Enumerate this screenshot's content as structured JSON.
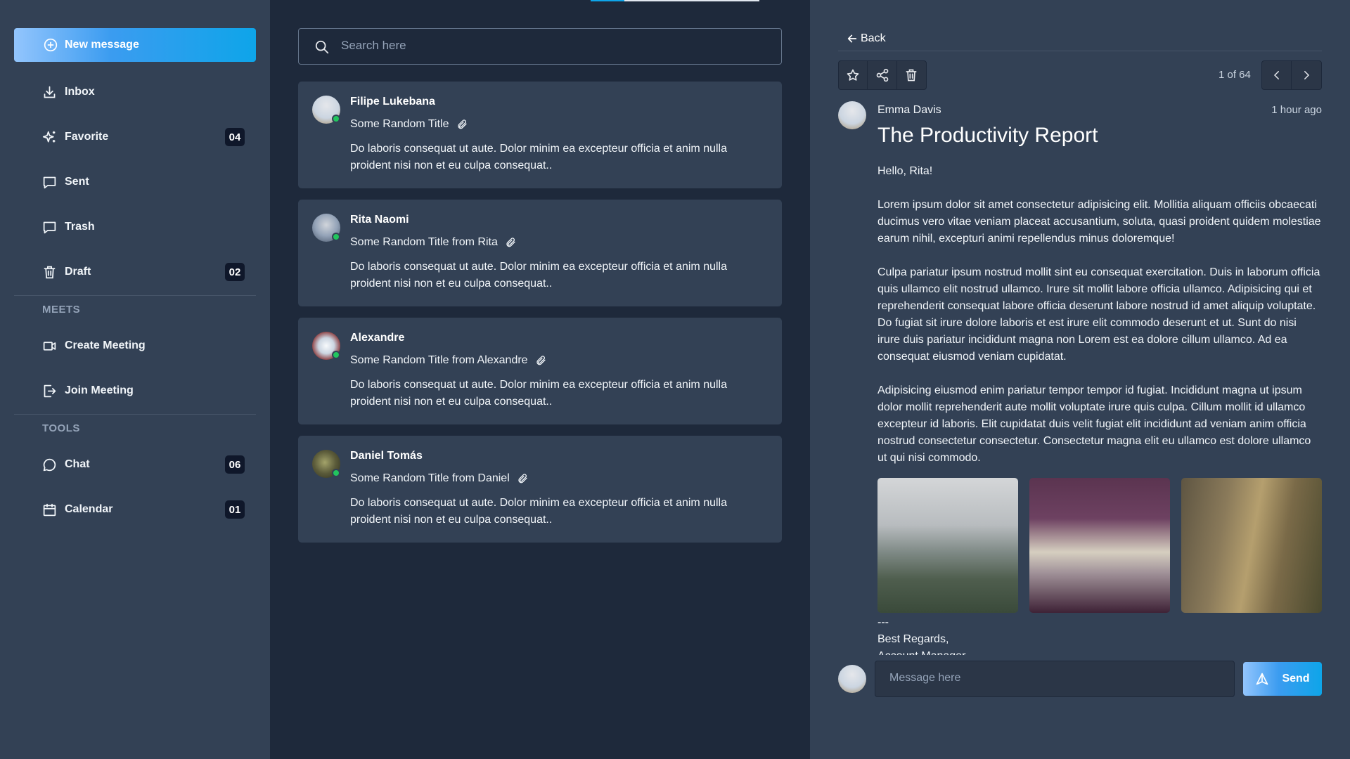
{
  "sidebar": {
    "new_message": "New message",
    "items": [
      {
        "label": "Inbox",
        "icon": "inbox-icon",
        "badge": ""
      },
      {
        "label": "Favorite",
        "icon": "sparkle-icon",
        "badge": "04"
      },
      {
        "label": "Sent",
        "icon": "message-icon",
        "badge": ""
      },
      {
        "label": "Trash",
        "icon": "message-icon",
        "badge": ""
      },
      {
        "label": "Draft",
        "icon": "trash-icon",
        "badge": "02"
      }
    ],
    "meets_label": "MEETS",
    "meets": [
      {
        "label": "Create Meeting",
        "icon": "video-icon"
      },
      {
        "label": "Join Meeting",
        "icon": "login-icon"
      }
    ],
    "tools_label": "TOOLS",
    "tools": [
      {
        "label": "Chat",
        "icon": "chat-icon",
        "badge": "06"
      },
      {
        "label": "Calendar",
        "icon": "calendar-icon",
        "badge": "01"
      }
    ]
  },
  "search": {
    "placeholder": "Search here"
  },
  "messages": [
    {
      "sender": "Filipe Lukebana",
      "subject": "Some Random Title",
      "preview": "Do laboris consequat ut aute. Dolor minim ea excepteur officia et anim nulla proident nisi non et eu culpa consequat.."
    },
    {
      "sender": "Rita Naomi",
      "subject": "Some Random Title from Rita",
      "preview": "Do laboris consequat ut aute. Dolor minim ea excepteur officia et anim nulla proident nisi non et eu culpa consequat.."
    },
    {
      "sender": "Alexandre",
      "subject": "Some Random Title from Alexandre",
      "preview": "Do laboris consequat ut aute. Dolor minim ea excepteur officia et anim nulla proident nisi non et eu culpa consequat.."
    },
    {
      "sender": "Daniel Tomás",
      "subject": "Some Random Title from Daniel",
      "preview": "Do laboris consequat ut aute. Dolor minim ea excepteur officia et anim nulla proident nisi non et eu culpa consequat.."
    }
  ],
  "reader": {
    "back": "Back",
    "pager": "1 of 64",
    "sender": "Emma Davis",
    "time": "1 hour ago",
    "title": "The Productivity Report",
    "greeting": "Hello, Rita!",
    "paragraphs": [
      "Lorem ipsum dolor sit amet consectetur adipisicing elit. Mollitia aliquam officiis obcaecati ducimus vero vitae veniam placeat accusantium, soluta, quasi proident quidem molestiae earum nihil, excepturi animi repellendus minus doloremque!",
      "Culpa pariatur ipsum nostrud mollit sint eu consequat exercitation. Duis in laborum officia quis ullamco elit nostrud ullamco. Irure sit mollit labore officia ullamco. Adipisicing qui et reprehenderit consequat labore officia deserunt labore nostrud id amet aliquip voluptate. Do fugiat sit irure dolore laboris et est irure elit commodo deserunt et ut. Sunt do nisi irure duis pariatur incididunt magna non Lorem est ea dolore cillum ullamco. Ad ea consequat eiusmod veniam cupidatat.",
      "Adipisicing eiusmod enim pariatur tempor tempor id fugiat. Incididunt magna ut ipsum dolor mollit reprehenderit aute mollit voluptate irure quis culpa. Cillum mollit id ullamco excepteur id laboris. Elit cupidatat duis velit fugiat elit incididunt ad veniam anim officia nostrud consectetur consectetur. Consectetur magna elit eu ullamco est dolore ullamco ut qui nisi commodo."
    ],
    "separator": "---",
    "regards": "Best Regards,",
    "role": "Account Manager",
    "reply_placeholder": "Message here",
    "send": "Send"
  },
  "colors": {
    "sidebar_bg": "#334155",
    "list_bg": "#1e293b",
    "card_bg": "#334155",
    "accent": "#0ea5e9",
    "badge_bg": "#0f172a",
    "online": "#22c55e"
  }
}
